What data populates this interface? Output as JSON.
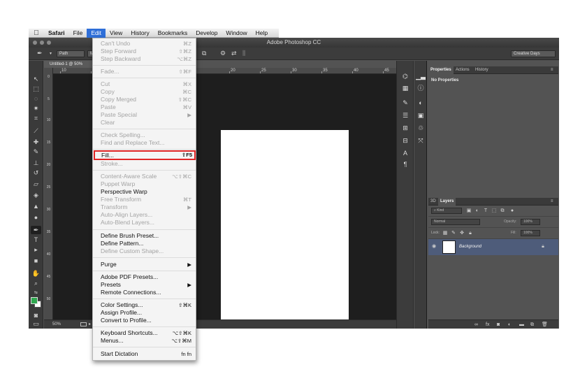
{
  "menubar": {
    "apple": "",
    "items": [
      "Safari",
      "File",
      "Edit",
      "View",
      "History",
      "Bookmarks",
      "Develop",
      "Window",
      "Help"
    ]
  },
  "window": {
    "title": "Adobe Photoshop CC"
  },
  "options_bar": {
    "mode": "Path",
    "mode2": "M",
    "workspace": "Creative Days"
  },
  "document": {
    "tab": "Untitled-1 @ 50%",
    "ruler_top": [
      "10",
      "5",
      "20",
      "25",
      "30",
      "35",
      "40",
      "45"
    ],
    "ruler_left": [
      "0",
      "5",
      "10",
      "15",
      "20",
      "25",
      "30",
      "35",
      "40",
      "45",
      "50"
    ],
    "zoom": "50%"
  },
  "panels": {
    "properties_tabs": [
      "Properties",
      "Actions",
      "History"
    ],
    "no_properties": "No Properties",
    "layers_tabs": [
      "3D",
      "Layers"
    ],
    "kind": "Kind",
    "blend": "Normal",
    "opacity_label": "Opacity:",
    "opacity": "100%",
    "lock_label": "Lock:",
    "fill_label": "Fill:",
    "fill": "100%",
    "layer_name": "Background"
  },
  "edit_menu": {
    "items": [
      {
        "label": "Can't Undo",
        "shortcut": "⌘Z"
      },
      {
        "label": "Step Forward",
        "shortcut": "⇧⌘Z"
      },
      {
        "label": "Step Backward",
        "shortcut": "⌥⌘Z"
      },
      {
        "label": "Fade...",
        "shortcut": "⇧⌘F"
      },
      {
        "label": "Cut",
        "shortcut": "⌘X"
      },
      {
        "label": "Copy",
        "shortcut": "⌘C"
      },
      {
        "label": "Copy Merged",
        "shortcut": "⇧⌘C"
      },
      {
        "label": "Paste",
        "shortcut": "⌘V"
      },
      {
        "label": "Paste Special",
        "shortcut": "▶"
      },
      {
        "label": "Clear",
        "shortcut": ""
      },
      {
        "label": "Check Spelling...",
        "shortcut": ""
      },
      {
        "label": "Find and Replace Text...",
        "shortcut": ""
      },
      {
        "label": "Fill...",
        "shortcut": "⇧F5"
      },
      {
        "label": "Stroke...",
        "shortcut": ""
      },
      {
        "label": "Content-Aware Scale",
        "shortcut": "⌥⇧⌘C"
      },
      {
        "label": "Puppet Warp",
        "shortcut": ""
      },
      {
        "label": "Perspective Warp",
        "shortcut": ""
      },
      {
        "label": "Free Transform",
        "shortcut": "⌘T"
      },
      {
        "label": "Transform",
        "shortcut": "▶"
      },
      {
        "label": "Auto-Align Layers...",
        "shortcut": ""
      },
      {
        "label": "Auto-Blend Layers...",
        "shortcut": ""
      },
      {
        "label": "Define Brush Preset...",
        "shortcut": ""
      },
      {
        "label": "Define Pattern...",
        "shortcut": ""
      },
      {
        "label": "Define Custom Shape...",
        "shortcut": ""
      },
      {
        "label": "Purge",
        "shortcut": "▶"
      },
      {
        "label": "Adobe PDF Presets...",
        "shortcut": ""
      },
      {
        "label": "Presets",
        "shortcut": "▶"
      },
      {
        "label": "Remote Connections...",
        "shortcut": ""
      },
      {
        "label": "Color Settings...",
        "shortcut": "⇧⌘K"
      },
      {
        "label": "Assign Profile...",
        "shortcut": ""
      },
      {
        "label": "Convert to Profile...",
        "shortcut": ""
      },
      {
        "label": "Keyboard Shortcuts...",
        "shortcut": "⌥⇧⌘K"
      },
      {
        "label": "Menus...",
        "shortcut": "⌥⇧⌘M"
      },
      {
        "label": "Start Dictation",
        "shortcut": "fn fn"
      }
    ]
  },
  "colors": {
    "foreground": "#2fa84f",
    "background": "#ffffff",
    "highlight": "#e02525"
  }
}
